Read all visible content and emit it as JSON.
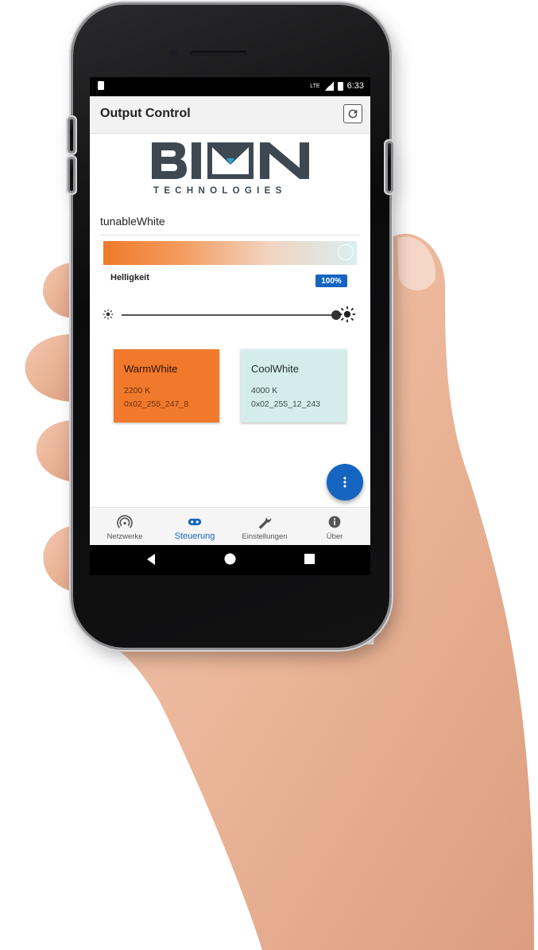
{
  "colors": {
    "primary": "#1565c0",
    "warm_card": "#f0792b",
    "cool_card": "#d5ecec",
    "appbar_bg": "#f2f2f2"
  },
  "status_bar": {
    "time": "6:33",
    "network": "LTE"
  },
  "appbar": {
    "title": "Output Control",
    "refresh_icon": "refresh-icon"
  },
  "logo": {
    "name": "BION",
    "subtitle": "TECHNOLOGIES"
  },
  "device": {
    "name": "tunableWhite"
  },
  "color_temperature_bar": {
    "level": 1.0
  },
  "brightness": {
    "label": "Helligkeit",
    "value_text": "100%",
    "value": 100,
    "min_icon": "sun-small-icon",
    "max_icon": "sun-large-icon"
  },
  "presets": [
    {
      "name": "WarmWhite",
      "kelvin": "2200 K",
      "code": "0x02_255_247_8"
    },
    {
      "name": "CoolWhite",
      "kelvin": "4000 K",
      "code": "0x02_255_12_243"
    }
  ],
  "fab": {
    "icon": "more-vert-icon"
  },
  "bottom_nav": {
    "items": [
      {
        "label": "Netzwerke",
        "icon": "wifi-icon",
        "active": false
      },
      {
        "label": "Steuerung",
        "icon": "toggle-icon",
        "active": true
      },
      {
        "label": "Einstellungen",
        "icon": "wrench-icon",
        "active": false
      },
      {
        "label": "Über",
        "icon": "info-icon",
        "active": false
      }
    ]
  },
  "system_nav": {
    "back_icon": "back-triangle-icon",
    "home_icon": "home-circle-icon",
    "recents_icon": "recents-square-icon"
  }
}
